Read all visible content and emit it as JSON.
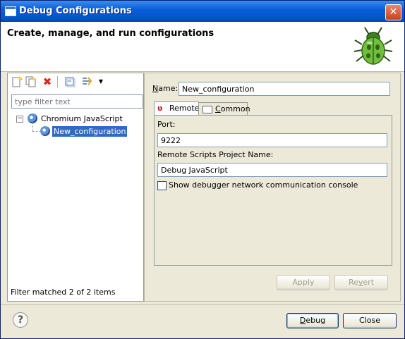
{
  "window": {
    "title": "Debug Configurations",
    "close_glyph": "✕"
  },
  "banner": {
    "title": "Create, manage, and run configurations",
    "icon": "bug-icon"
  },
  "left": {
    "toolbar": [
      {
        "name": "new-config-icon"
      },
      {
        "name": "duplicate-icon"
      },
      {
        "name": "delete-icon"
      },
      {
        "name": "collapse-all-icon"
      },
      {
        "name": "filter-icon"
      }
    ],
    "filter_placeholder": "type filter text",
    "tree": {
      "root_toggle": "−",
      "root_label": "Chromium JavaScript",
      "child_label": "New_configuration"
    },
    "status": "Filter matched 2 of 2 items"
  },
  "right": {
    "name_label_mnemonic": "N",
    "name_label_rest": "ame:",
    "name_value": "New_configuration",
    "tabs": [
      {
        "label": "Remote",
        "active": true
      },
      {
        "label": "Common",
        "mnemonic": "C",
        "rest": "ommon",
        "active": false
      }
    ],
    "port_label": "Port:",
    "port_value": "9222",
    "project_label": "Remote Scripts Project Name:",
    "project_value": "Debug JavaScript",
    "console_checkbox_label": "Show debugger network communication console",
    "console_checked": false,
    "apply_label": "Apply",
    "apply_mnemonic": "y",
    "revert_label_pre": "Re",
    "revert_mnemonic": "v",
    "revert_label_post": "ert"
  },
  "footer": {
    "help_glyph": "?",
    "debug_label_mnemonic": "D",
    "debug_label_rest": "ebug",
    "close_label": "Close"
  },
  "colors": {
    "titlebar": "#0a5fd8",
    "selection": "#316ac5",
    "dialog_bg": "#ece9d8"
  }
}
